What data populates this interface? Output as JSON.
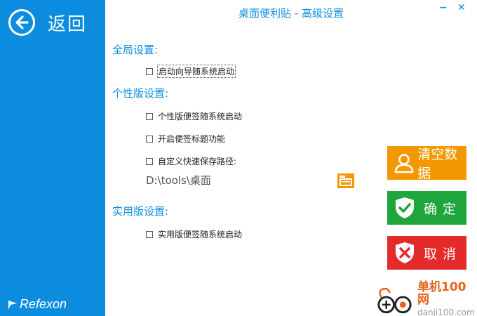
{
  "window": {
    "title": "桌面便利贴 - 高级设置",
    "minimize_glyph": "−",
    "close_glyph": "✕"
  },
  "sidebar": {
    "back_label": "返回",
    "brand": "Refexon"
  },
  "sections": {
    "global": {
      "title": "全局设置:",
      "options": [
        {
          "label": "启动向导随系统启动",
          "checked": false
        }
      ]
    },
    "personal": {
      "title": "个性版设置:",
      "options": [
        {
          "label": "个性版便签随系统启动",
          "checked": false
        },
        {
          "label": "开启便签标题功能",
          "checked": false
        },
        {
          "label": "自定义快速保存路径:",
          "checked": false
        }
      ],
      "path": "D:\\tools\\桌面"
    },
    "practical": {
      "title": "实用版设置:",
      "options": [
        {
          "label": "实用版便签随系统启动",
          "checked": false
        }
      ]
    }
  },
  "actions": {
    "clear": {
      "label": "清空数据",
      "color": "#f39800"
    },
    "ok": {
      "label": "确定",
      "color": "#1ea53c"
    },
    "cancel": {
      "label": "取消",
      "color": "#e52a2a"
    }
  },
  "watermark": {
    "name": "单机100网",
    "url": "danji100.com"
  },
  "colors": {
    "accent": "#0d8de0"
  }
}
